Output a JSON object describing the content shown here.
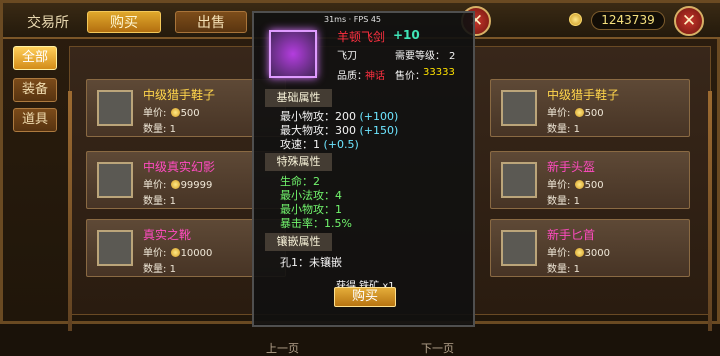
{
  "header": {
    "title": "交易所",
    "buy_label": "购买",
    "sell_label": "出售",
    "gold": "1243739"
  },
  "sidebar": {
    "tabs": [
      {
        "label": "全部"
      },
      {
        "label": "装备"
      },
      {
        "label": "道具"
      }
    ]
  },
  "items": [
    {
      "name": "中级猎手鞋子",
      "price": "500",
      "qty": "1",
      "color": "#ffd54b"
    },
    {
      "name": "中级真实幻影",
      "price": "99999",
      "qty": "1",
      "color": "#ff4bc0"
    },
    {
      "name": "真实之靴",
      "price": "10000",
      "qty": "1",
      "color": "#ff4bc0"
    },
    {
      "name": "中级猎手鞋子",
      "price": "500",
      "qty": "1",
      "color": "#ffd54b"
    },
    {
      "name": "新手头盔",
      "price": "500",
      "qty": "1",
      "color": "#ff4bc0"
    },
    {
      "name": "新手匕首",
      "price": "3000",
      "qty": "1",
      "color": "#ff4bc0"
    }
  ],
  "tooltip": {
    "fps": "31ms · FPS 45",
    "name": "羊顿飞剑",
    "plus": "+10",
    "subtype": "飞刀",
    "req_label": "需要等级：",
    "req_level": "2",
    "quality_label": "品质：",
    "quality": "神话",
    "price_label": "售价：",
    "price": "33333",
    "sections": [
      {
        "title": "基础属性",
        "stats": [
          {
            "label": "最小物攻：",
            "value": "200",
            "bonus": "(+100)"
          },
          {
            "label": "最大物攻：",
            "value": "300",
            "bonus": "(+150)"
          },
          {
            "label": "攻速：",
            "value": "1",
            "bonus": "(+0.5)"
          }
        ]
      },
      {
        "title": "特殊属性",
        "stats": [
          {
            "label": "生命：",
            "value": "2",
            "bonus": ""
          },
          {
            "label": "最小法攻：",
            "value": "4",
            "bonus": ""
          },
          {
            "label": "最小物攻：",
            "value": "1",
            "bonus": ""
          },
          {
            "label": "暴击率：",
            "value": "1.5%",
            "bonus": ""
          }
        ]
      },
      {
        "title": "镶嵌属性",
        "stats": [
          {
            "label": "孔1：",
            "value": "未镶嵌",
            "bonus": ""
          }
        ]
      }
    ],
    "footer": "获得 铁矿 x1",
    "buy_label": "购买"
  },
  "pager": {
    "prev": "上一页",
    "next": "下一页"
  }
}
